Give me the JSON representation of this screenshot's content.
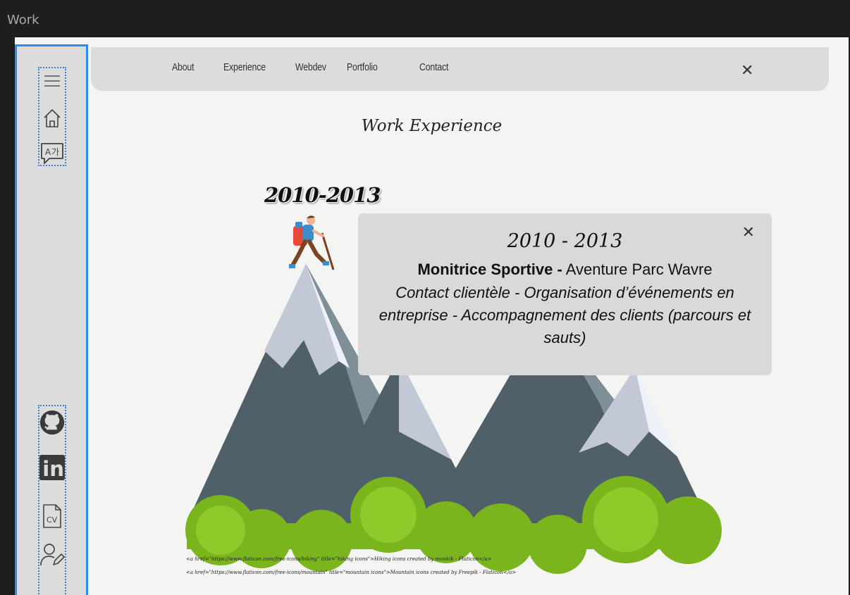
{
  "window": {
    "title": "Work"
  },
  "nav": {
    "items": [
      "About",
      "Experience",
      "Webdev",
      "Portfolio",
      "Contact"
    ],
    "close_glyph": "✕"
  },
  "page": {
    "heading": "Work Experience",
    "year_tag": "2010-2013"
  },
  "popup": {
    "years": "2010 - 2013",
    "role": "Monitrice Sportive -",
    "company": " Aventure Parc Wavre",
    "description": "Contact clientèle - Organisation d’événements en entreprise - Accompagnement des clients (parcours et sauts)",
    "close_glyph": "✕"
  },
  "credits": [
    "<a href=\"https://www.flaticon.com/free-icons/hiking\" title=\"hiking icons\">Hiking icons created by monkik - Flaticon</a>",
    "<a href=\"https://www.flaticon.com/free-icons/mountain\" title=\"mountain icons\">Mountain icons created by Freepik - Flaticon</a>"
  ],
  "sidebar": {
    "top_icons": [
      "menu-icon",
      "home-icon",
      "translate-icon"
    ],
    "bottom_icons": [
      "github-icon",
      "linkedin-icon",
      "cv-file-icon",
      "edit-user-icon"
    ],
    "cv_label": "CV",
    "linkedin_label": "in"
  },
  "colors": {
    "sidebar_border": "#2a8cf2",
    "sidebar_bg": "#dcdcdc",
    "mountain_dark": "#4f6069",
    "mountain_light": "#c3c8d6",
    "snow": "#eef1f8",
    "foliage": "#7ab51d"
  }
}
